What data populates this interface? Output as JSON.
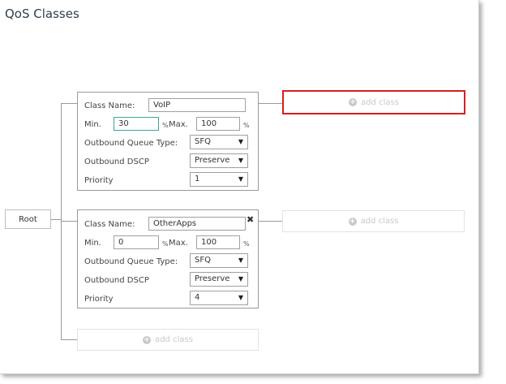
{
  "page": {
    "title": "QoS Classes"
  },
  "root": {
    "label": "Root"
  },
  "labels": {
    "class_name": "Class Name:",
    "min": "Min.",
    "max": "Max.",
    "percent": "%",
    "queue_type": "Outbound Queue Type:",
    "dscp": "Outbound DSCP",
    "priority": "Priority"
  },
  "classes": [
    {
      "name": "VoIP",
      "min": "30",
      "max": "100",
      "queue_type": "SFQ",
      "dscp": "Preserve",
      "priority": "1"
    },
    {
      "name": "OtherApps",
      "min": "0",
      "max": "100",
      "queue_type": "SFQ",
      "dscp": "Preserve",
      "priority": "4"
    }
  ],
  "add_class": {
    "label": "add class"
  },
  "icons": {
    "close": "close-icon",
    "add": "plus-circle-icon",
    "dropdown": "chevron-down-icon"
  },
  "colors": {
    "highlight": "#d81e1e",
    "focus_border": "#3aa79a"
  }
}
